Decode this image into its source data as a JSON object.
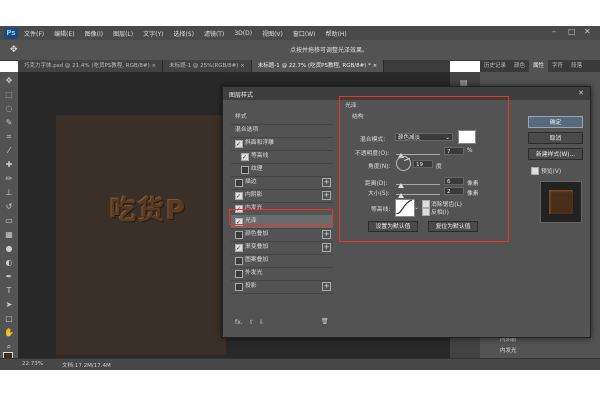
{
  "app": {
    "logo": "Ps"
  },
  "menu": [
    "文件(F)",
    "编辑(E)",
    "图像(I)",
    "图层(L)",
    "文字(Y)",
    "选择(S)",
    "滤镜(T)",
    "3D(D)",
    "视图(V)",
    "窗口(W)",
    "帮助(H)"
  ],
  "window_controls": [
    "–",
    "□",
    "✕"
  ],
  "options_bar": {
    "caption": "点按并拖移可调整光泽效果。"
  },
  "doc_tabs": [
    {
      "label": "巧克力字体.psd @ 21.4% (吃货PS教程, RGB/8#)",
      "close": "×"
    },
    {
      "label": "未标题-1 @ 25%(RGB/8#)",
      "close": "×"
    },
    {
      "label": "未标题-1 @ 22.7% (吃货PS教程, RGB/8#) *",
      "close": "×"
    }
  ],
  "canvas": {
    "text": "吃货P"
  },
  "panels": {
    "tabs": [
      "历史记录",
      "颜色",
      "属性",
      "字符",
      "段落"
    ],
    "active": "属性"
  },
  "status": {
    "zoom": "22.73%",
    "doc": "文档:17.2M/17.4M"
  },
  "layers_peek": [
    "内阴影",
    "内发光"
  ],
  "dialog": {
    "title": "图层样式",
    "close": "✕",
    "style_items": [
      {
        "label": "样式",
        "checkbox": false,
        "checked": false,
        "plus": false,
        "sub": false
      },
      {
        "label": "混合选项",
        "checkbox": false,
        "checked": false,
        "plus": false,
        "sub": false
      },
      {
        "label": "斜面和浮雕",
        "checkbox": true,
        "checked": true,
        "plus": false,
        "sub": false
      },
      {
        "label": "等高线",
        "checkbox": true,
        "checked": true,
        "plus": false,
        "sub": true
      },
      {
        "label": "纹理",
        "checkbox": true,
        "checked": false,
        "plus": false,
        "sub": true
      },
      {
        "label": "描边",
        "checkbox": true,
        "checked": false,
        "plus": true,
        "sub": false
      },
      {
        "label": "内阴影",
        "checkbox": true,
        "checked": true,
        "plus": true,
        "sub": false
      },
      {
        "label": "内发光",
        "checkbox": true,
        "checked": true,
        "plus": false,
        "sub": false
      },
      {
        "label": "光泽",
        "checkbox": true,
        "checked": true,
        "plus": false,
        "sub": false,
        "selected": true
      },
      {
        "label": "颜色叠加",
        "checkbox": true,
        "checked": false,
        "plus": true,
        "sub": false
      },
      {
        "label": "渐变叠加",
        "checkbox": true,
        "checked": true,
        "plus": true,
        "sub": false
      },
      {
        "label": "图案叠加",
        "checkbox": true,
        "checked": false,
        "plus": false,
        "sub": false
      },
      {
        "label": "外发光",
        "checkbox": true,
        "checked": false,
        "plus": false,
        "sub": false
      },
      {
        "label": "投影",
        "checkbox": true,
        "checked": false,
        "plus": true,
        "sub": false
      }
    ],
    "fx_bar": {
      "fx": "fx.",
      "up": "⇧",
      "down": "⇩",
      "delete": "🗑"
    },
    "satin": {
      "section": "光泽",
      "structure": "结构",
      "blend_mode_label": "混合模式:",
      "blend_mode": "颜色减淡",
      "opacity_label": "不透明度(O):",
      "opacity": "7",
      "opacity_unit": "%",
      "angle_label": "角度(N):",
      "angle": "19",
      "angle_unit": "度",
      "distance_label": "距离(D):",
      "distance": "6",
      "distance_unit": "像素",
      "size_label": "大小(S):",
      "size": "2",
      "size_unit": "像素",
      "contour_label": "等高线:",
      "antialias_label": "消除锯齿(L)",
      "invert_label": "反相(I)",
      "default_btn": "设置为默认值",
      "reset_btn": "复位为默认值",
      "color": "#ffffff"
    },
    "buttons": {
      "ok": "确定",
      "cancel": "取消",
      "new_style": "新建样式(W)...",
      "preview": "预览(V)"
    }
  }
}
